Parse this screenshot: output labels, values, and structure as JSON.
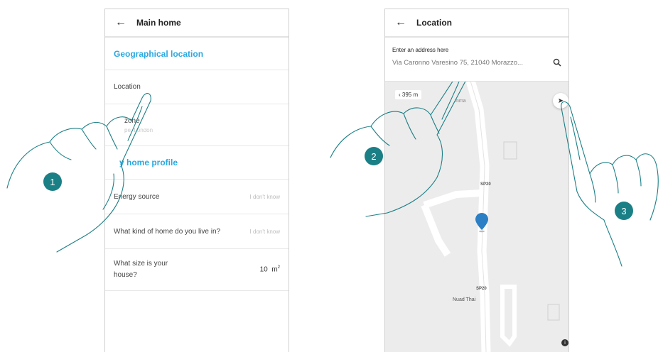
{
  "left_screen": {
    "header": {
      "back_icon": "arrow-left-icon",
      "title": "Main home"
    },
    "section1_title": "Geographical location",
    "location_label": "Location",
    "timezone_label": "zone",
    "timezone_value": "pe, London",
    "section2_title": "y home profile",
    "energy_label": "Energy source",
    "energy_value": "I don't know",
    "home_kind_label": "What kind of home do you live in?",
    "home_kind_value": "I don't know",
    "size_label_line1": "What size is your",
    "size_label_line2": "house?",
    "size_value": "10",
    "size_unit": "m",
    "size_unit_sup": "2"
  },
  "right_screen": {
    "header": {
      "back_icon": "arrow-left-icon",
      "title": "Location"
    },
    "address_label": "Enter an address here",
    "address_value": "Via Caronno Varesino 75, 21040 Morazzo...",
    "search_icon": "search-icon",
    "map": {
      "scale": "395 m",
      "place_fragment": "mma",
      "road_label_1": "SP20",
      "road_label_2": "SP20",
      "poi_label": "Nuad Thai",
      "locate_icon": "navigation-arrow-icon",
      "info_icon": "info-icon",
      "pin_color": "#2b7fc4"
    }
  },
  "callouts": [
    "1",
    "2",
    "3"
  ],
  "colors": {
    "accent": "#2ba8df",
    "callout": "#1b7f86",
    "hand_outline": "#1b7f86"
  }
}
